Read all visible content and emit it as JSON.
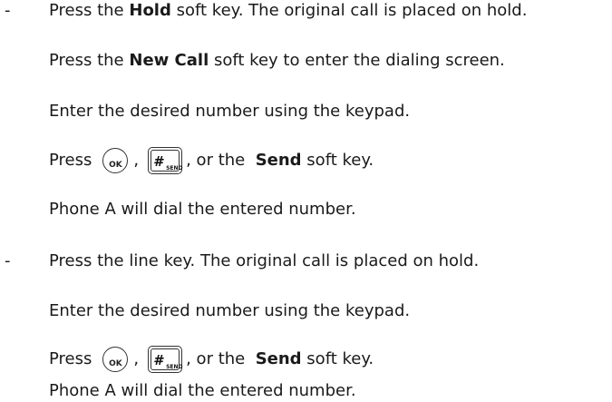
{
  "bullet": "-",
  "section1": {
    "line1": {
      "pre": "Press the ",
      "bold": "Hold",
      "post": " soft key. The original call is placed on hold."
    },
    "line2": {
      "pre": "Press the ",
      "bold": "New Call",
      "post": " soft key to enter the dialing screen."
    },
    "line3": "Enter the desired number using the keypad.",
    "line4": {
      "pre": "Press",
      "comma": ",",
      "post": ", or the ",
      "bold": "Send",
      "post2": " soft key."
    },
    "line5": "Phone A will dial the entered number."
  },
  "section2": {
    "line1": "Press the line key. The original call is placed on hold.",
    "line2": "Enter the desired number using the keypad.",
    "line3": {
      "pre": "Press",
      "comma": ",",
      "post": ", or the ",
      "bold": "Send",
      "post2": " soft key."
    },
    "line4": "Phone A will dial the entered number."
  },
  "icons": {
    "ok_label": "OK",
    "hash_label": "#",
    "send_label": "SEND"
  }
}
